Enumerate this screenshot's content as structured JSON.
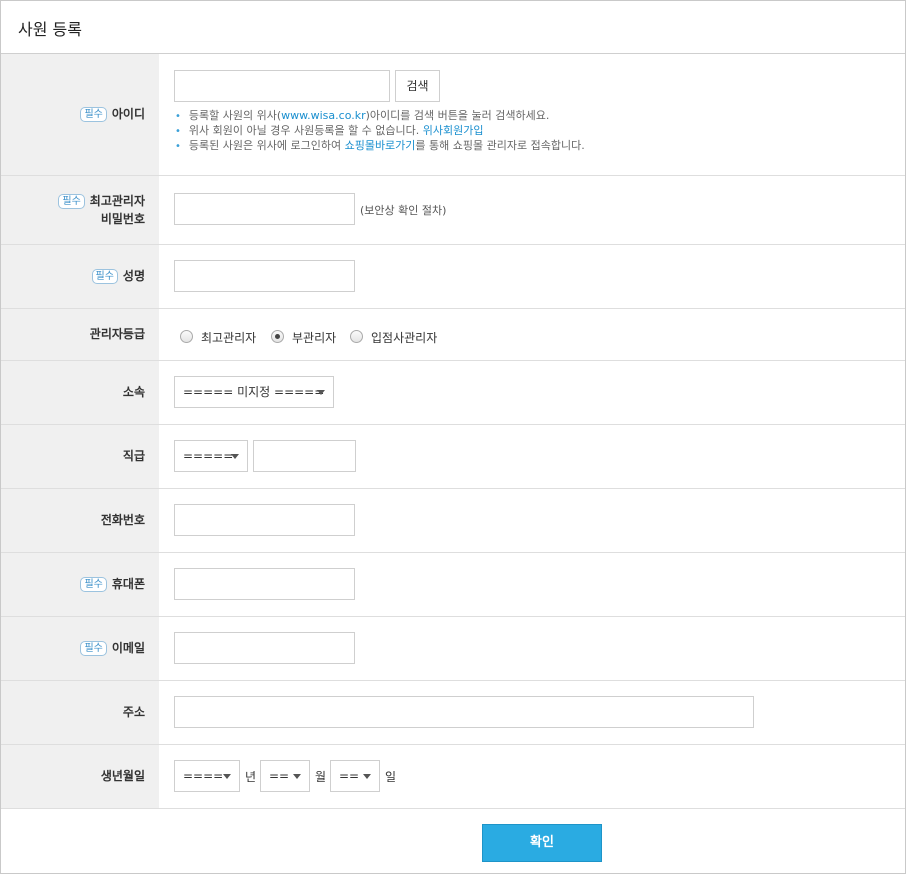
{
  "title": "사원 등록",
  "required_badge": "필수",
  "rows": {
    "id": {
      "label": "아이디",
      "search_button": "검색",
      "notes": [
        {
          "text_before": "등록할 사원의 위사(",
          "link": "www.wisa.co.kr",
          "text_after": ")아이디를 검색 버튼을 눌러 검색하세요."
        },
        {
          "text_before": "위사 회원이 아닐 경우 사원등록을 할 수 없습니다.",
          "link": "위사회원가입",
          "text_after": ""
        },
        {
          "text_before": "등록된 사원은 위사에 로그인하여 ",
          "link": "쇼핑몰바로가기",
          "text_after": "를 통해 쇼핑몰 관리자로 접속합니다."
        }
      ]
    },
    "password": {
      "label_line1": "최고관리자",
      "label_line2": "비밀번호",
      "hint": "(보안상 확인 절차)"
    },
    "name": {
      "label": "성명"
    },
    "grade": {
      "label": "관리자등급",
      "options": [
        "최고관리자",
        "부관리자",
        "입점사관리자"
      ],
      "selected": "부관리자"
    },
    "dept": {
      "label": "소속",
      "selected": "===== 미지정 ====="
    },
    "position": {
      "label": "직급",
      "selected": "====="
    },
    "phone": {
      "label": "전화번호"
    },
    "mobile": {
      "label": "휴대폰"
    },
    "email": {
      "label": "이메일"
    },
    "address": {
      "label": "주소"
    },
    "birth": {
      "label": "생년월일",
      "year": "====",
      "year_unit": "년",
      "month": "==",
      "month_unit": "월",
      "day": "==",
      "day_unit": "일"
    }
  },
  "confirm_button": "확인"
}
